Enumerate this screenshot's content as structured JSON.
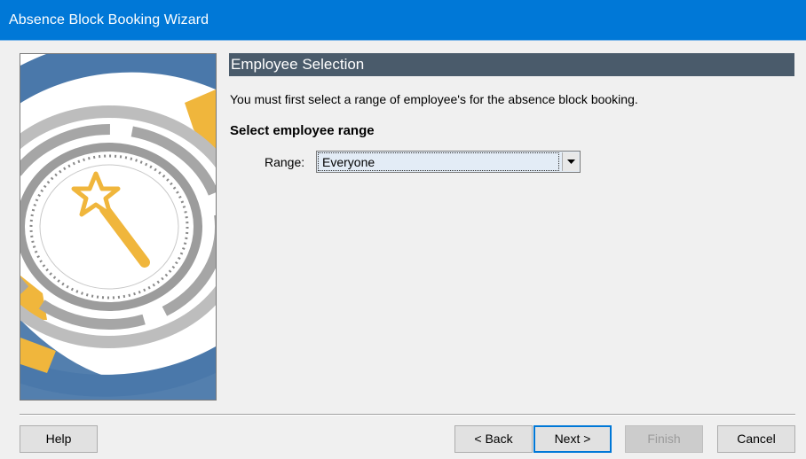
{
  "window": {
    "title": "Absence Block Booking Wizard"
  },
  "page": {
    "header": "Employee Selection",
    "intro": "You must first select a range of employee's for the absence block booking.",
    "section_heading": "Select employee range",
    "range_label": "Range:",
    "range_value": "Everyone"
  },
  "buttons": {
    "help": "Help",
    "back": "< Back",
    "next": "Next >",
    "finish": "Finish",
    "cancel": "Cancel"
  },
  "icons": {
    "wizard_art": "magic-wand-clock-illustration",
    "dropdown": "chevron-down-icon"
  },
  "colors": {
    "titlebar": "#0078d7",
    "header_bar": "#4a5b6b",
    "art_blue": "#4a78aa",
    "art_gold": "#f0b63c",
    "art_gray": "#a6a6a6"
  }
}
